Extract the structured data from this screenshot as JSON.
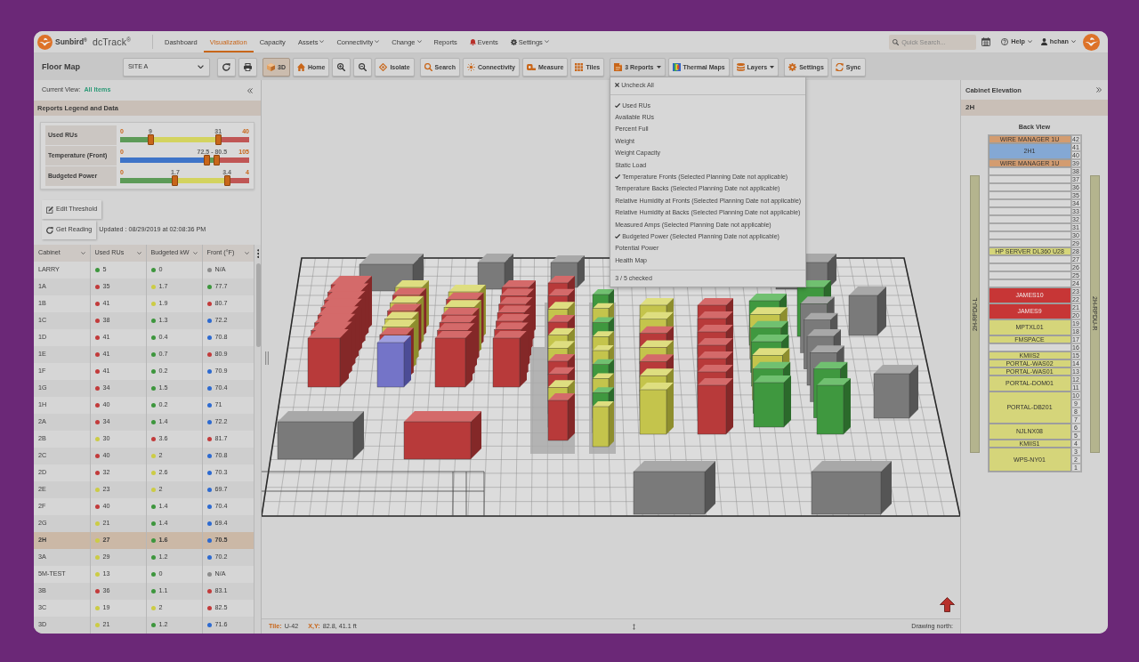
{
  "window": {
    "brand": "Sunbird$^{®}$",
    "product": "dcTrack$^{®}$"
  },
  "nav": {
    "items": [
      {
        "label": "Dashboard",
        "selected": false,
        "dropdown": false
      },
      {
        "label": "Visualization",
        "selected": true,
        "dropdown": false
      },
      {
        "label": "Capacity",
        "selected": false,
        "dropdown": false
      },
      {
        "label": "Assets",
        "selected": false,
        "dropdown": true
      },
      {
        "label": "Connectivity",
        "selected": false,
        "dropdown": true
      },
      {
        "label": "Change",
        "selected": false,
        "dropdown": true
      },
      {
        "label": "Reports",
        "selected": false,
        "dropdown": false
      },
      {
        "label": "Events",
        "selected": false,
        "dropdown": false
      },
      {
        "label": "Settings",
        "selected": false,
        "dropdown": true
      }
    ],
    "search": {
      "placeholder": "Quick Search..."
    },
    "help": "Help",
    "user": "hchan"
  },
  "toolbar": {
    "title": "Floor Map",
    "site": "SITE A",
    "button_groups": [
      [
        {
          "selected": false,
          "dropdown": false,
          "expanded": false
        },
        {
          "selected": false,
          "dropdown": false,
          "expanded": false
        }
      ],
      [
        {
          "label": "3D",
          "selected": true,
          "dropdown": false,
          "expanded": false
        },
        {
          "label": "Home",
          "selected": false,
          "dropdown": false,
          "expanded": false
        },
        {
          "selected": false,
          "dropdown": false,
          "expanded": false
        },
        {
          "selected": false,
          "dropdown": false,
          "expanded": false
        },
        {
          "label": "Isolate",
          "selected": false,
          "dropdown": false,
          "expanded": false
        }
      ],
      [
        {
          "label": "Search",
          "selected": false,
          "dropdown": false,
          "expanded": false
        },
        {
          "label": "Connectivity",
          "selected": false,
          "dropdown": false,
          "expanded": false
        },
        {
          "label": "Measure",
          "selected": false,
          "dropdown": false,
          "expanded": false
        },
        {
          "label": "Tiles",
          "selected": false,
          "dropdown": false,
          "expanded": false
        }
      ],
      [
        {
          "label": "3 Reports",
          "selected": false,
          "dropdown": true,
          "expanded": true
        },
        {
          "label": "Thermal Maps",
          "selected": false,
          "dropdown": false,
          "expanded": false
        },
        {
          "label": "Layers",
          "selected": false,
          "dropdown": true,
          "expanded": false
        }
      ],
      [
        {
          "label": "Settings",
          "selected": false,
          "dropdown": false,
          "expanded": false
        },
        {
          "label": "Sync",
          "selected": false,
          "dropdown": false,
          "expanded": false
        }
      ]
    ],
    "reports_menu": {
      "uncheck_all": "Uncheck All",
      "items": [
        {
          "label": "Used RUs",
          "checked": true
        },
        {
          "label": "Available RUs",
          "checked": false
        },
        {
          "label": "Percent Full",
          "checked": false
        },
        {
          "label": "Weight",
          "checked": false
        },
        {
          "label": "Weight Capacity",
          "checked": false
        },
        {
          "label": "Static Load",
          "checked": false
        },
        {
          "label": "Temperature Fronts (Selected Planning Date not applicable)",
          "checked": true
        },
        {
          "label": "Temperature Backs (Selected Planning Date not applicable)",
          "checked": false
        },
        {
          "label": "Relative Humidity at Fronts (Selected Planning Date not applicable)",
          "checked": false
        },
        {
          "label": "Relative Humidity at Backs (Selected Planning Date not applicable)",
          "checked": false
        },
        {
          "label": "Measured Amps (Selected Planning Date not applicable)",
          "checked": false
        },
        {
          "label": "Budgeted Power (Selected Planning Date not applicable)",
          "checked": true
        },
        {
          "label": "Potential Power",
          "checked": false
        },
        {
          "label": "Health Map",
          "checked": false
        }
      ],
      "footer": "3 / 5 checked"
    }
  },
  "left_panel": {
    "current_view_label": "Current View:",
    "current_view": "All Items",
    "legend_title": "Reports Legend and Data",
    "legend": [
      {
        "name": "Used RUs",
        "labels": [
          "0",
          "9",
          "31",
          "40"
        ],
        "thumbs": [
          {
            "level": 0.235
          },
          {
            "level": 0.76
          }
        ],
        "zones": [
          {
            "color": "#5d9b58"
          },
          {
            "color": "#d3d35f"
          },
          {
            "color": "#c05655"
          }
        ]
      },
      {
        "name": "Temperature (Front)",
        "labels": [
          "0",
          "72.5 - 80.5",
          "105"
        ],
        "thumbs": [
          {
            "level": 0.675
          },
          {
            "level": 0.75
          }
        ],
        "zones": [
          {
            "color": "#3e74c8"
          },
          {
            "color": "#5d9b58"
          },
          {
            "color": "#c05655"
          }
        ]
      },
      {
        "name": "Budgeted Power",
        "labels": [
          "0",
          "1.7",
          "3.4",
          "4"
        ],
        "thumbs": [
          {
            "level": 0.427
          },
          {
            "level": 0.828
          }
        ],
        "zones": [
          {
            "color": "#5d9b58"
          },
          {
            "color": "#d3d35f"
          },
          {
            "color": "#c05655"
          }
        ]
      }
    ],
    "actions": [
      "Edit Threshold",
      "Get Reading"
    ],
    "updated": "Updated : 08/29/2019 at 02:08:36 PM",
    "table": {
      "columns": [
        "Cabinet",
        "Used RUs",
        "Budgeted kW",
        "Front (°F)"
      ],
      "rows": [
        {
          "selected": false,
          "cells": [
            {
              "text": "LARRY"
            },
            {
              "text": "5",
              "color": "#3d963d"
            },
            {
              "text": "0",
              "color": "#3d963d"
            },
            {
              "text": "N/A",
              "color": "#8c8c8c"
            }
          ]
        },
        {
          "selected": false,
          "cells": [
            {
              "text": "1A"
            },
            {
              "text": "35",
              "color": "#c23b3b"
            },
            {
              "text": "1.7",
              "color": "#cccc45"
            },
            {
              "text": "77.7",
              "color": "#3d963d"
            }
          ]
        },
        {
          "selected": false,
          "cells": [
            {
              "text": "1B"
            },
            {
              "text": "41",
              "color": "#c23b3b"
            },
            {
              "text": "1.9",
              "color": "#cccc45"
            },
            {
              "text": "80.7",
              "color": "#c23b3b"
            }
          ]
        },
        {
          "selected": false,
          "cells": [
            {
              "text": "1C"
            },
            {
              "text": "38",
              "color": "#c23b3b"
            },
            {
              "text": "1.3",
              "color": "#3d963d"
            },
            {
              "text": "72.2",
              "color": "#2d6ad0"
            }
          ]
        },
        {
          "selected": false,
          "cells": [
            {
              "text": "1D"
            },
            {
              "text": "41",
              "color": "#c23b3b"
            },
            {
              "text": "0.4",
              "color": "#3d963d"
            },
            {
              "text": "70.8",
              "color": "#2d6ad0"
            }
          ]
        },
        {
          "selected": false,
          "cells": [
            {
              "text": "1E"
            },
            {
              "text": "41",
              "color": "#c23b3b"
            },
            {
              "text": "0.7",
              "color": "#3d963d"
            },
            {
              "text": "80.9",
              "color": "#c23b3b"
            }
          ]
        },
        {
          "selected": false,
          "cells": [
            {
              "text": "1F"
            },
            {
              "text": "41",
              "color": "#c23b3b"
            },
            {
              "text": "0.2",
              "color": "#3d963d"
            },
            {
              "text": "70.9",
              "color": "#2d6ad0"
            }
          ]
        },
        {
          "selected": false,
          "cells": [
            {
              "text": "1G"
            },
            {
              "text": "34",
              "color": "#c23b3b"
            },
            {
              "text": "1.5",
              "color": "#3d963d"
            },
            {
              "text": "70.4",
              "color": "#2d6ad0"
            }
          ]
        },
        {
          "selected": false,
          "cells": [
            {
              "text": "1H"
            },
            {
              "text": "40",
              "color": "#c23b3b"
            },
            {
              "text": "0.2",
              "color": "#3d963d"
            },
            {
              "text": "71",
              "color": "#2d6ad0"
            }
          ]
        },
        {
          "selected": false,
          "cells": [
            {
              "text": "2A"
            },
            {
              "text": "34",
              "color": "#c23b3b"
            },
            {
              "text": "1.4",
              "color": "#3d963d"
            },
            {
              "text": "72.2",
              "color": "#2d6ad0"
            }
          ]
        },
        {
          "selected": false,
          "cells": [
            {
              "text": "2B"
            },
            {
              "text": "30",
              "color": "#cccc45"
            },
            {
              "text": "3.6",
              "color": "#c23b3b"
            },
            {
              "text": "81.7",
              "color": "#c23b3b"
            }
          ]
        },
        {
          "selected": false,
          "cells": [
            {
              "text": "2C"
            },
            {
              "text": "40",
              "color": "#c23b3b"
            },
            {
              "text": "2",
              "color": "#cccc45"
            },
            {
              "text": "70.8",
              "color": "#2d6ad0"
            }
          ]
        },
        {
          "selected": false,
          "cells": [
            {
              "text": "2D"
            },
            {
              "text": "32",
              "color": "#c23b3b"
            },
            {
              "text": "2.6",
              "color": "#cccc45"
            },
            {
              "text": "70.3",
              "color": "#2d6ad0"
            }
          ]
        },
        {
          "selected": false,
          "cells": [
            {
              "text": "2E"
            },
            {
              "text": "23",
              "color": "#cccc45"
            },
            {
              "text": "2",
              "color": "#cccc45"
            },
            {
              "text": "69.7",
              "color": "#2d6ad0"
            }
          ]
        },
        {
          "selected": false,
          "cells": [
            {
              "text": "2F"
            },
            {
              "text": "40",
              "color": "#c23b3b"
            },
            {
              "text": "1.4",
              "color": "#3d963d"
            },
            {
              "text": "70.4",
              "color": "#2d6ad0"
            }
          ]
        },
        {
          "selected": false,
          "cells": [
            {
              "text": "2G"
            },
            {
              "text": "21",
              "color": "#cccc45"
            },
            {
              "text": "1.4",
              "color": "#3d963d"
            },
            {
              "text": "69.4",
              "color": "#2d6ad0"
            }
          ]
        },
        {
          "selected": true,
          "cells": [
            {
              "text": "2H"
            },
            {
              "text": "27",
              "color": "#cccc45"
            },
            {
              "text": "1.6",
              "color": "#3d963d"
            },
            {
              "text": "70.5",
              "color": "#2d6ad0"
            }
          ]
        },
        {
          "selected": false,
          "cells": [
            {
              "text": "3A"
            },
            {
              "text": "29",
              "color": "#cccc45"
            },
            {
              "text": "1.2",
              "color": "#3d963d"
            },
            {
              "text": "70.2",
              "color": "#2d6ad0"
            }
          ]
        },
        {
          "selected": false,
          "cells": [
            {
              "text": "5M-TEST"
            },
            {
              "text": "13",
              "color": "#cccc45"
            },
            {
              "text": "0",
              "color": "#3d963d"
            },
            {
              "text": "N/A",
              "color": "#8c8c8c"
            }
          ]
        },
        {
          "selected": false,
          "cells": [
            {
              "text": "3B"
            },
            {
              "text": "36",
              "color": "#c23b3b"
            },
            {
              "text": "1.1",
              "color": "#3d963d"
            },
            {
              "text": "83.1",
              "color": "#c23b3b"
            }
          ]
        },
        {
          "selected": false,
          "cells": [
            {
              "text": "3C"
            },
            {
              "text": "19",
              "color": "#cccc45"
            },
            {
              "text": "2",
              "color": "#cccc45"
            },
            {
              "text": "82.5",
              "color": "#c23b3b"
            }
          ]
        },
        {
          "selected": false,
          "cells": [
            {
              "text": "3D"
            },
            {
              "text": "21",
              "color": "#cccc45"
            },
            {
              "text": "1.2",
              "color": "#3d963d"
            },
            {
              "text": "71.6",
              "color": "#2d6ad0"
            }
          ]
        }
      ]
    }
  },
  "canvas": {
    "status": {
      "tile_label": "Tile:",
      "tile": "U-42",
      "xy_label": "X,Y:",
      "xy": "82.8, 41.1 ft",
      "north_label": "Drawing north:"
    }
  },
  "right_panel": {
    "title": "Cabinet Elevation",
    "cabinet": "2H",
    "view": "Back View",
    "pdus": [
      "2H-RPDU-L",
      "2H-RPDU-R"
    ],
    "slots": [
      {
        "name": "WIRE MANAGER 1U",
        "color": "#d39c70",
        "units": [
          "42"
        ]
      },
      {
        "name": "2H1",
        "color": "#84a8d4",
        "units": [
          "41",
          "40"
        ]
      },
      {
        "name": "WIRE MANAGER 1U",
        "color": "#d39c70",
        "units": [
          "39"
        ]
      },
      {
        "units": [
          "38"
        ]
      },
      {
        "units": [
          "37"
        ]
      },
      {
        "units": [
          "36"
        ]
      },
      {
        "units": [
          "35"
        ]
      },
      {
        "units": [
          "34"
        ]
      },
      {
        "units": [
          "33"
        ]
      },
      {
        "units": [
          "32"
        ]
      },
      {
        "units": [
          "31"
        ]
      },
      {
        "units": [
          "30"
        ]
      },
      {
        "units": [
          "29"
        ]
      },
      {
        "name": "HP SERVER DL360 U28",
        "color": "#d5d57a",
        "units": [
          "28"
        ]
      },
      {
        "units": [
          "27"
        ]
      },
      {
        "units": [
          "26"
        ]
      },
      {
        "units": [
          "25"
        ]
      },
      {
        "units": [
          "24"
        ]
      },
      {
        "name": "JAMES10",
        "color": "#c73636",
        "units": [
          "23",
          "22"
        ]
      },
      {
        "name": "JAMES9",
        "color": "#c73636",
        "units": [
          "21",
          "20"
        ]
      },
      {
        "name": "MPTXL01",
        "color": "#d5d57a",
        "units": [
          "19",
          "18"
        ]
      },
      {
        "name": "FMSPACE",
        "color": "#d5d57a",
        "units": [
          "17"
        ]
      },
      {
        "units": [
          "16"
        ]
      },
      {
        "name": "KMIIS2",
        "color": "#d5d57a",
        "units": [
          "15"
        ]
      },
      {
        "name": "PORTAL-WAS02",
        "color": "#d5d57a",
        "units": [
          "14"
        ]
      },
      {
        "name": "PORTAL-WAS01",
        "color": "#d5d57a",
        "units": [
          "13"
        ]
      },
      {
        "name": "PORTAL-DOM01",
        "color": "#d5d57a",
        "units": [
          "12",
          "11"
        ]
      },
      {
        "name": "PORTAL-DB201",
        "color": "#d5d57a",
        "units": [
          "10",
          "9",
          "8",
          "7"
        ]
      },
      {
        "name": "NJLNX08",
        "color": "#d5d57a",
        "units": [
          "6",
          "5"
        ]
      },
      {
        "name": "KMIIS1",
        "color": "#d5d57a",
        "units": [
          "4"
        ]
      },
      {
        "name": "WPS-NY01",
        "color": "#d5d57a",
        "units": [
          "3",
          "2",
          "1"
        ]
      }
    ]
  }
}
